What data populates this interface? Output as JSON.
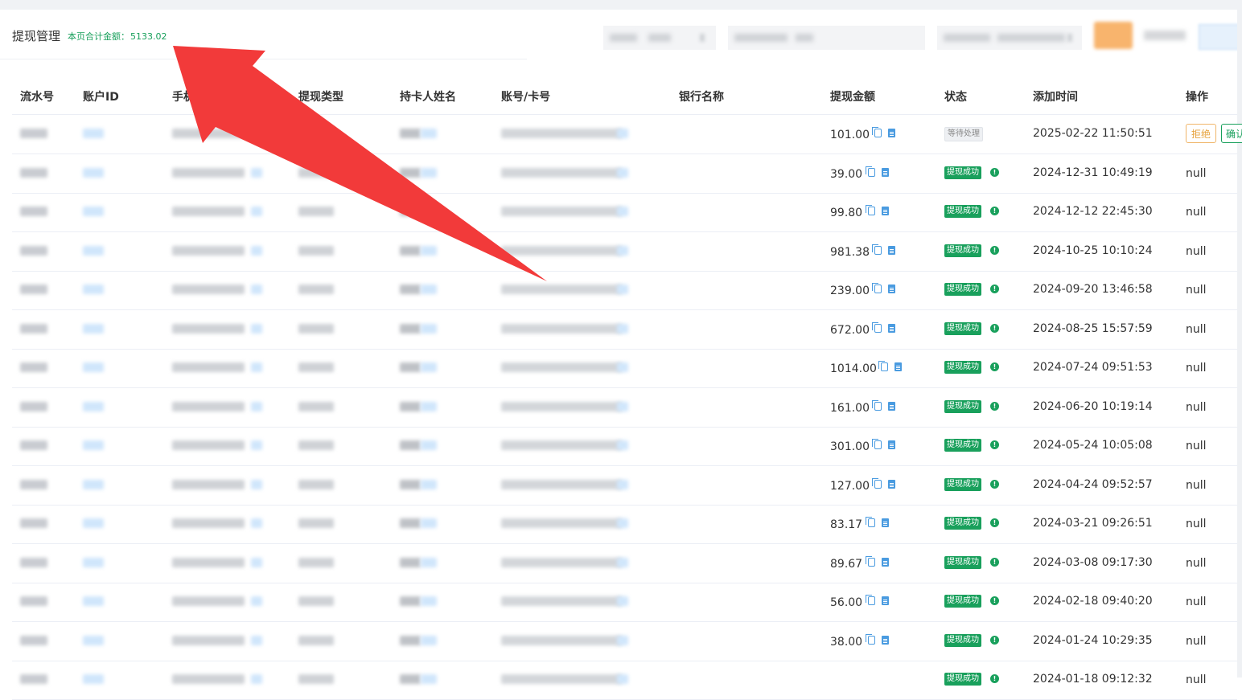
{
  "header": {
    "title": "提现管理",
    "total_label": "本页合计金额：",
    "total_value": "5133.02"
  },
  "columns": [
    "流水号",
    "账户ID",
    "手机号",
    "提现类型",
    "持卡人姓名",
    "账号/卡号",
    "银行名称",
    "提现金额",
    "状态",
    "添加时间",
    "操作"
  ],
  "rows": [
    {
      "amount": "101.00",
      "status": "等待处理",
      "time": "2025-02-22 11:50:51",
      "op": "",
      "reject": "拒绝",
      "confirm": "确认"
    },
    {
      "amount": "39.00",
      "status": "提现成功",
      "time": "2024-12-31 10:49:19",
      "op": "null"
    },
    {
      "amount": "99.80",
      "status": "提现成功",
      "time": "2024-12-12 22:45:30",
      "op": "null"
    },
    {
      "amount": "981.38",
      "status": "提现成功",
      "time": "2024-10-25 10:10:24",
      "op": "null"
    },
    {
      "amount": "239.00",
      "status": "提现成功",
      "time": "2024-09-20 13:46:58",
      "op": "null"
    },
    {
      "amount": "672.00",
      "status": "提现成功",
      "time": "2024-08-25 15:57:59",
      "op": "null"
    },
    {
      "amount": "1014.00",
      "status": "提现成功",
      "time": "2024-07-24 09:51:53",
      "op": "null"
    },
    {
      "amount": "161.00",
      "status": "提现成功",
      "time": "2024-06-20 10:19:14",
      "op": "null"
    },
    {
      "amount": "301.00",
      "status": "提现成功",
      "time": "2024-05-24 10:05:08",
      "op": "null"
    },
    {
      "amount": "127.00",
      "status": "提现成功",
      "time": "2024-04-24 09:52:57",
      "op": "null"
    },
    {
      "amount": "83.17",
      "status": "提现成功",
      "time": "2024-03-21 09:26:51",
      "op": "null"
    },
    {
      "amount": "89.67",
      "status": "提现成功",
      "time": "2024-03-08 09:17:30",
      "op": "null"
    },
    {
      "amount": "56.00",
      "status": "提现成功",
      "time": "2024-02-18 09:40:20",
      "op": "null"
    },
    {
      "amount": "38.00",
      "status": "提现成功",
      "time": "2024-01-24 10:29:35",
      "op": "null"
    },
    {
      "amount": "",
      "status": "提现成功",
      "time": "2024-01-18 09:12:32",
      "op": "null"
    }
  ],
  "colors": {
    "success": "#19a05c",
    "accent_arrow": "#f23a3a",
    "icon": "#4a9be0",
    "warning": "#e6a23c"
  },
  "icons": [
    "copy-icon",
    "document-icon",
    "info-dot-icon"
  ]
}
